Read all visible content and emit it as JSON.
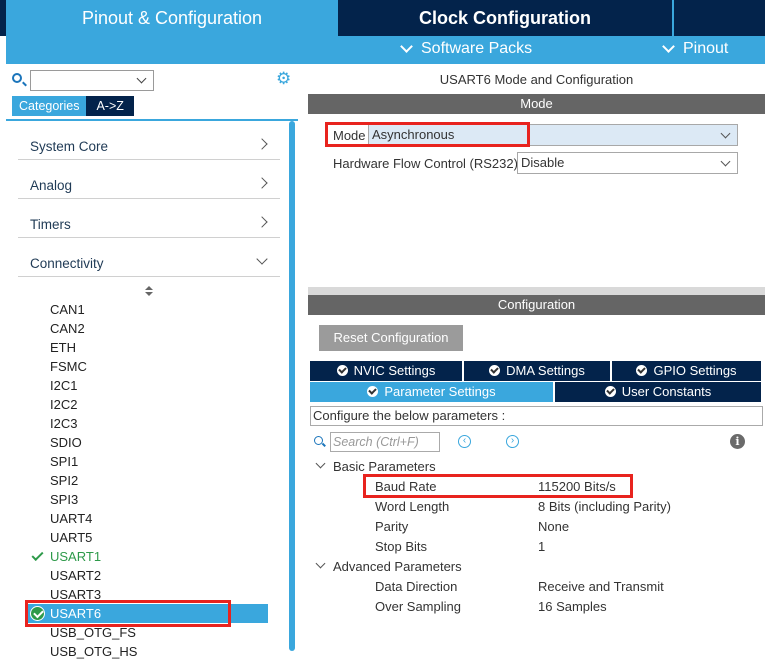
{
  "top_tabs": {
    "pinout_config": "Pinout & Configuration",
    "clock_config": "Clock Configuration"
  },
  "sub_bar": {
    "software_packs": "Software Packs",
    "pinout": "Pinout"
  },
  "left": {
    "search_value": "",
    "tabs": [
      "Categories",
      "A->Z"
    ],
    "categories": [
      "System Core",
      "Analog",
      "Timers",
      "Connectivity"
    ],
    "peripherals": [
      "CAN1",
      "CAN2",
      "ETH",
      "FSMC",
      "I2C1",
      "I2C2",
      "I2C3",
      "SDIO",
      "SPI1",
      "SPI2",
      "SPI3",
      "UART4",
      "UART5",
      "USART1",
      "USART2",
      "USART3",
      "USART6",
      "USB_OTG_FS",
      "USB_OTG_HS"
    ],
    "configured": [
      "USART1",
      "USART6"
    ],
    "selected": "USART6"
  },
  "right": {
    "title": "USART6 Mode and Configuration",
    "mode_section": "Mode",
    "mode_label": "Mode",
    "mode_value": "Asynchronous",
    "hw_flow_label": "Hardware Flow Control (RS232)",
    "hw_flow_value": "Disable",
    "config_section": "Configuration",
    "reset_button": "Reset Configuration",
    "settings_tabs": {
      "nvic": "NVIC Settings",
      "dma": "DMA Settings",
      "gpio": "GPIO Settings",
      "parameter": "Parameter Settings",
      "user_constants": "User Constants"
    },
    "configure_text": "Configure the below parameters :",
    "search_placeholder": "Search (Ctrl+F)",
    "basic_parameters": "Basic Parameters",
    "advanced_parameters": "Advanced Parameters",
    "params": {
      "baud_rate": {
        "name": "Baud Rate",
        "value": "115200 Bits/s"
      },
      "word_length": {
        "name": "Word Length",
        "value": "8 Bits (including Parity)"
      },
      "parity": {
        "name": "Parity",
        "value": "None"
      },
      "stop_bits": {
        "name": "Stop Bits",
        "value": "1"
      },
      "data_direction": {
        "name": "Data Direction",
        "value": "Receive and Transmit"
      },
      "over_sampling": {
        "name": "Over Sampling",
        "value": "16 Samples"
      }
    }
  },
  "colors": {
    "accent": "#3aa7dd",
    "navy": "#03234b",
    "highlight_red": "#e8231e",
    "ok_green": "#2e9a4a"
  }
}
